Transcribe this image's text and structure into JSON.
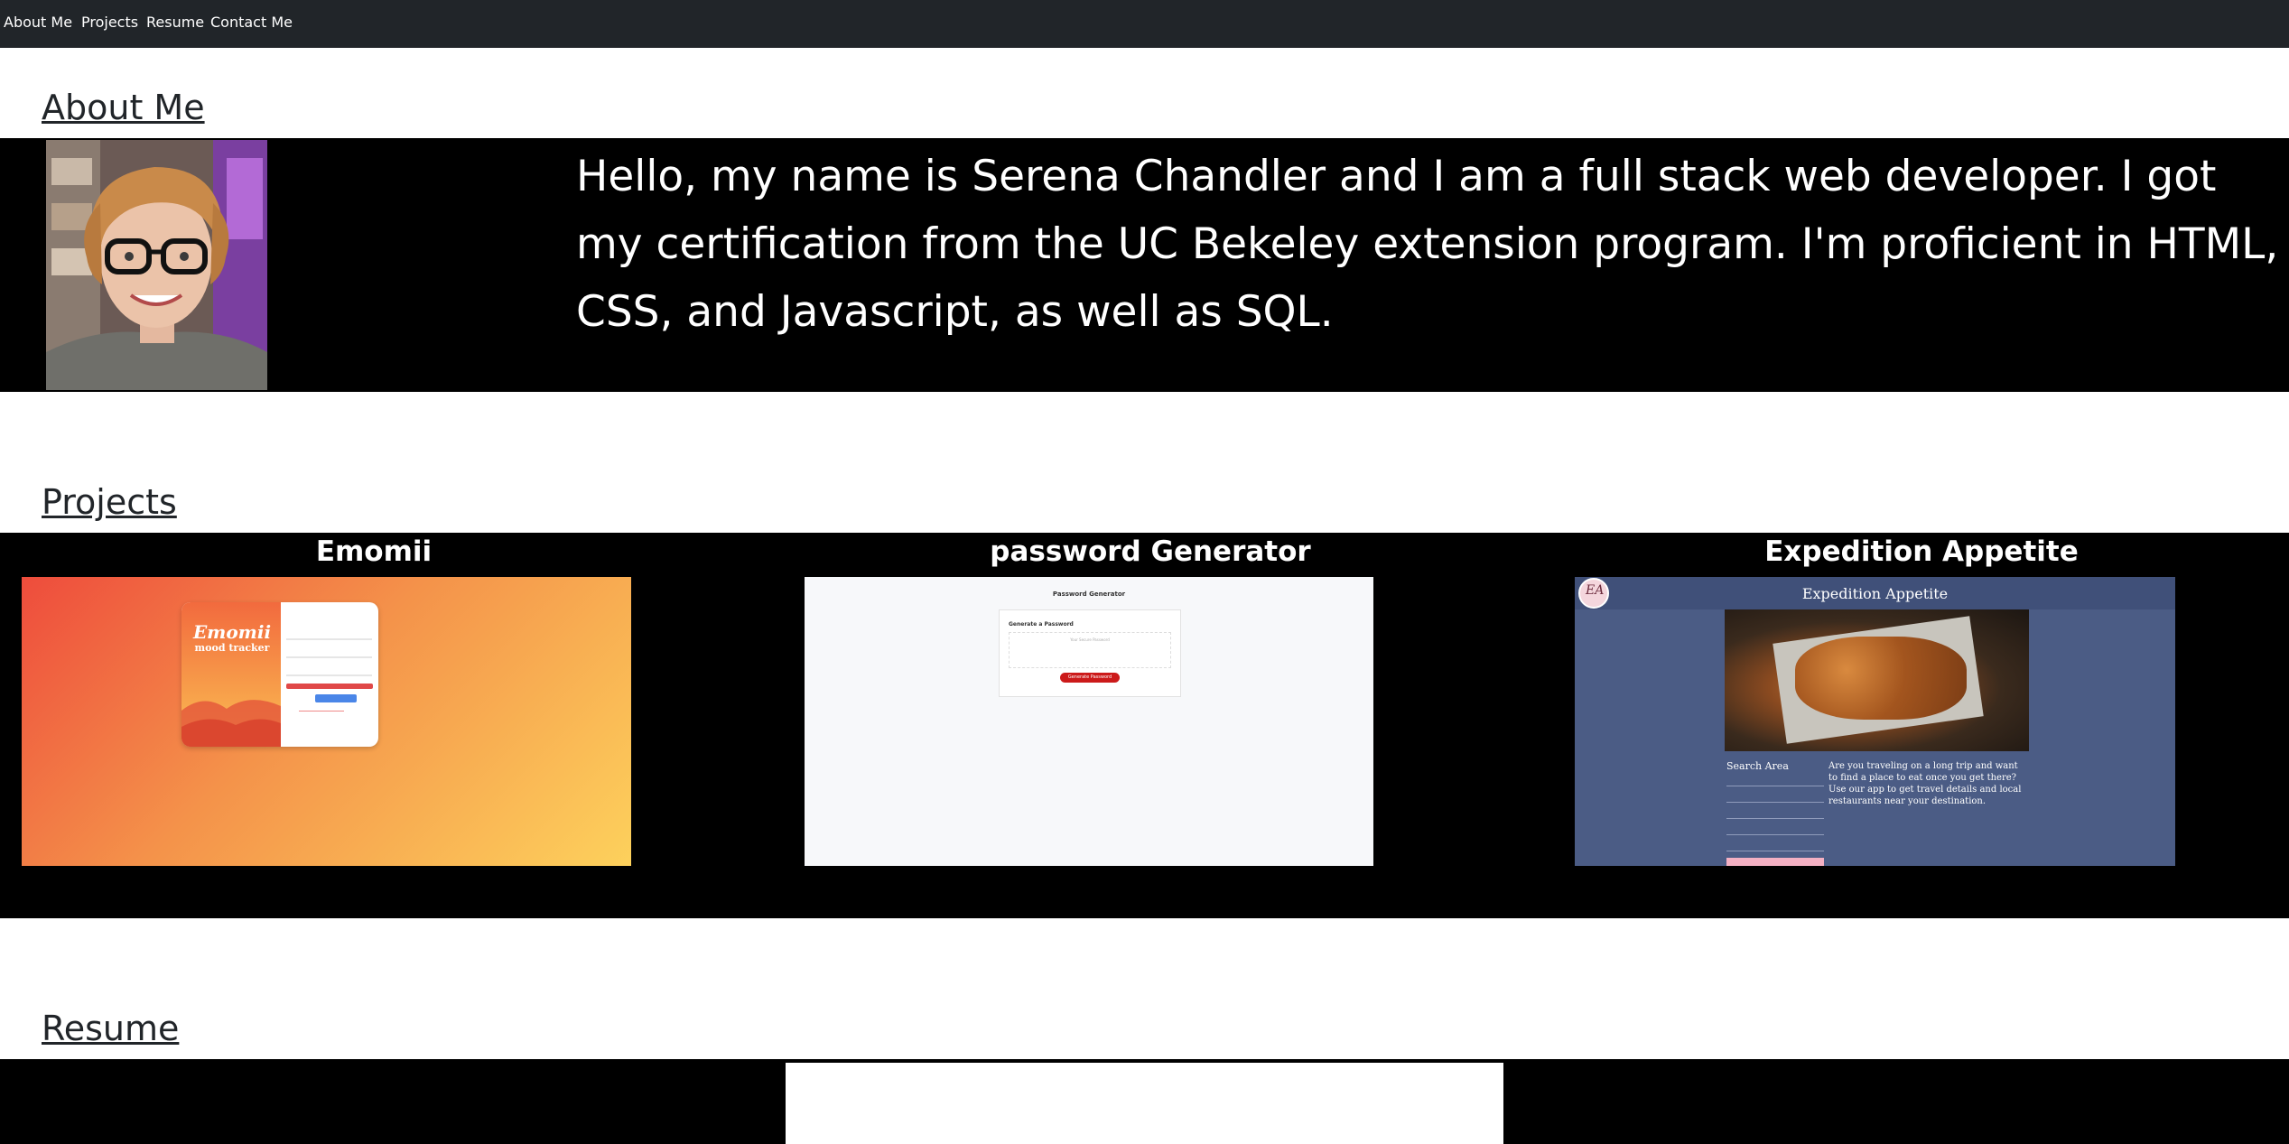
{
  "nav": {
    "items": [
      {
        "label": "About Me"
      },
      {
        "label": "Projects"
      },
      {
        "label": "Resume"
      },
      {
        "label": "Contact Me"
      }
    ]
  },
  "about": {
    "title": "About Me",
    "text": "Hello, my name is Serena Chandler and I am a full stack web developer. I got my certification from the UC Bekeley extension program. I'm proficient in HTML, CSS, and Javascript, as well as SQL."
  },
  "projects": {
    "title": "Projects",
    "items": [
      {
        "title": "Emomii",
        "logo_text": "Emomii",
        "logo_sub": "mood tracker"
      },
      {
        "title": "password Generator",
        "header": "Password Generator",
        "card_title": "Generate a Password",
        "placeholder": "Your Secure Password",
        "button": "Generate Password"
      },
      {
        "title": "Expedition Appetite",
        "header": "Expedition Appetite",
        "logo_text": "EA",
        "search_title": "Search Area",
        "description": "Are you traveling on a long trip and want to find a place to eat once you get there? Use our app to get travel details and local restaurants near your destination."
      }
    ]
  },
  "resume": {
    "title": "Resume"
  }
}
